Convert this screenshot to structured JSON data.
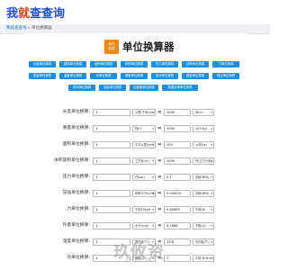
{
  "header": {
    "logo_part1": "我",
    "logo_part2": "就",
    "logo_part3": "查查询"
  },
  "breadcrumb": {
    "home": "我就查查询",
    "separator": " » ",
    "current": "单位换算器"
  },
  "title": {
    "badge_line1": "单位",
    "badge_line2": "换算",
    "text": "单位换算器"
  },
  "tools": [
    "长度单位换算",
    "重量单位换算",
    "面积单位换算",
    "体积单位换算",
    "压力单位换算",
    "功率单位换算",
    "力单位换算",
    "热量单位换算",
    "温度单位换算",
    "功单位换算",
    "速度单位换算",
    "电流单位换算",
    "角度单位换算",
    "电压单位换算",
    "时间单位换算",
    "流量单位换算",
    "加速度单位换算",
    "数据存储单位换算"
  ],
  "rows": [
    {
      "label": "长度单位换算:",
      "value1": "1",
      "unit1": "公里(千米)(km)",
      "value2": "1000",
      "unit2": "米(m)"
    },
    {
      "label": "重量单位换算:",
      "value1": "1",
      "unit1": "吨(t)",
      "value2": "1000",
      "unit2": "公斤(kg)"
    },
    {
      "label": "面积单位换算:",
      "value1": "1",
      "unit1": "平方公里(km²)",
      "value2": "100",
      "unit2": "公顷(ha)"
    },
    {
      "label": "体积容积单位换算:",
      "value1": "1",
      "unit1": "立方米(m³)",
      "value2": "1000",
      "unit2": "升(立方分米)(L)"
    },
    {
      "label": "压力单位换算:",
      "value1": "1",
      "unit1": "巴(bar)",
      "value2": "0.1",
      "unit2": "兆帕(MPa)"
    },
    {
      "label": "压强单位换算:",
      "value1": "1",
      "unit1": "帕斯卡(Pa=N/m²)",
      "value2": "0.000001",
      "unit2": "兆帕(MPa)"
    },
    {
      "label": "力单位换算:",
      "value1": "1",
      "unit1": "千克力(kgf)",
      "value2": "9.80665",
      "unit2": "牛顿(N)"
    },
    {
      "label": "热量单位换算:",
      "value1": "1",
      "unit1": "大卡(kcal)",
      "value2": "4.1868",
      "unit2": "千焦(kJ)"
    },
    {
      "label": "温度单位换算:",
      "value1": "1",
      "unit1": "摄氏度(°C)",
      "value2": "33.8",
      "unit2": "华氏度(°F)"
    },
    {
      "label": "功单位换算:",
      "value1": "1",
      "unit1": "焦耳(J)",
      "value2": "1",
      "unit2": "牛顿·米(N·m)"
    }
  ],
  "watermark": {
    "text": "玖攸资",
    "sub": "JIUYOUZI.COM"
  }
}
